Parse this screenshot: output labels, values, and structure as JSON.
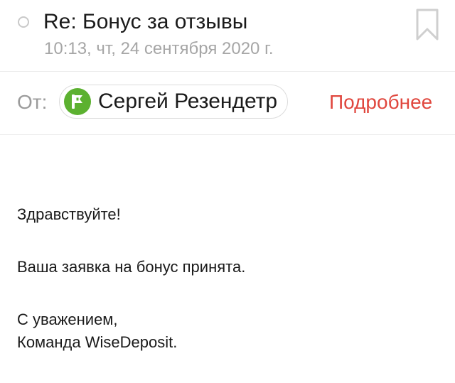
{
  "email": {
    "subject": "Re: Бонус за отзывы",
    "date": "10:13, чт, 24 сентября 2020 г.",
    "from_label": "От:",
    "sender_name": "Сергей Резендетр",
    "details_link": "Подробнее",
    "avatar_icon": "flag-icon",
    "colors": {
      "accent_link": "#e0473e",
      "avatar_bg": "#5cb130",
      "muted_text": "#a6a6a6"
    }
  },
  "message": {
    "greeting": "Здравствуйте!",
    "line1": "Ваша заявка на бонус принята.",
    "closing": "С уважением,",
    "signature": "Команда WiseDeposit."
  }
}
